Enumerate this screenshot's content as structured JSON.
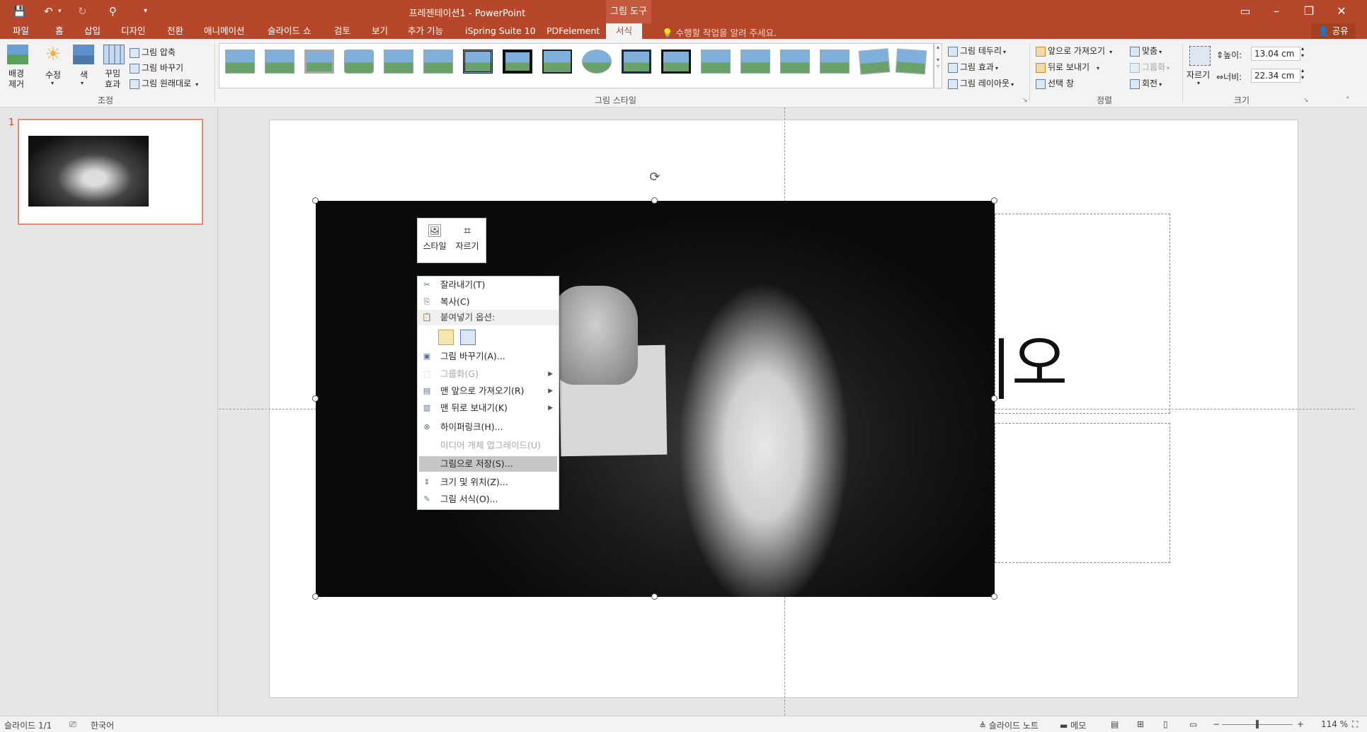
{
  "app": {
    "window_title": "프레젠테이션1 - PowerPoint",
    "context_tool": "그림 도구"
  },
  "quick_access": {
    "save_icon": "save-icon",
    "undo_icon": "undo-icon",
    "redo_icon": "redo-icon",
    "presenter_icon": "presenter-icon",
    "customize_icon": "chevron-down-icon"
  },
  "window_controls": {
    "ribbon_display": "▭",
    "minimize": "–",
    "maximize": "❐",
    "close": "✕"
  },
  "tabs": [
    {
      "label": "파일"
    },
    {
      "label": "홈"
    },
    {
      "label": "삽입"
    },
    {
      "label": "디자인"
    },
    {
      "label": "전환"
    },
    {
      "label": "애니메이션"
    },
    {
      "label": "슬라이드 쇼"
    },
    {
      "label": "검토"
    },
    {
      "label": "보기"
    },
    {
      "label": "추가 기능"
    },
    {
      "label": "iSpring Suite 10"
    },
    {
      "label": "PDFelement"
    },
    {
      "label": "서식"
    }
  ],
  "tell_me": "수행할 작업을 알려 주세요.",
  "share": "공유",
  "ribbon": {
    "adjust": {
      "remove_bg_line1": "배경",
      "remove_bg_line2": "제거",
      "corrections": "수정",
      "color": "색",
      "artistic_line1": "꾸밈",
      "artistic_line2": "효과",
      "compress": "그림 압축",
      "change": "그림 바꾸기",
      "reset": "그림 원래대로",
      "group_label": "조정"
    },
    "styles": {
      "group_label": "그림 스타일"
    },
    "picture_options": {
      "border": "그림 테두리",
      "effects": "그림 효과",
      "layout": "그림 레이아웃"
    },
    "arrange": {
      "bring_forward": "앞으로 가져오기",
      "send_backward": "뒤로 보내기",
      "selection_pane": "선택 창",
      "align": "맞춤",
      "group": "그룹화",
      "rotate": "회전",
      "group_label": "정렬"
    },
    "size": {
      "crop": "자르기",
      "height_label": "높이:",
      "height_value": "13.04 cm",
      "width_label": "너비:",
      "width_value": "22.34 cm",
      "group_label": "크기"
    }
  },
  "slides_panel": {
    "slide_number": "1"
  },
  "slide": {
    "title_fragment": "|오"
  },
  "mini_toolbar": {
    "style": "스타일",
    "crop": "자르기"
  },
  "context_menu": {
    "items": [
      {
        "label": "잘라내기(T)",
        "icon": "✂"
      },
      {
        "label": "복사(C)",
        "icon": "⎘"
      },
      {
        "label": "붙여넣기 옵션:",
        "icon": "📋"
      },
      {
        "label": "그림 바꾸기(A)...",
        "icon": "▣"
      },
      {
        "label": "그룹화(G)",
        "icon": "⬚"
      },
      {
        "label": "맨 앞으로 가져오기(R)",
        "icon": "▤"
      },
      {
        "label": "맨 뒤로 보내기(K)",
        "icon": "▥"
      },
      {
        "label": "하이퍼링크(H)...",
        "icon": "⊗"
      },
      {
        "label": "미디어 개체 업그레이드(U)",
        "icon": ""
      },
      {
        "label": "그림으로 저장(S)...",
        "icon": ""
      },
      {
        "label": "크기 및 위치(Z)...",
        "icon": "⇕"
      },
      {
        "label": "그림 서식(O)...",
        "icon": "✎"
      }
    ]
  },
  "status": {
    "slide_info": "슬라이드 1/1",
    "language": "한국어",
    "notes": "슬라이드 노트",
    "comments": "메모",
    "zoom": "114 %"
  },
  "colors": {
    "accent": "#b7472a",
    "selected_slide_border": "#e88a6d"
  }
}
